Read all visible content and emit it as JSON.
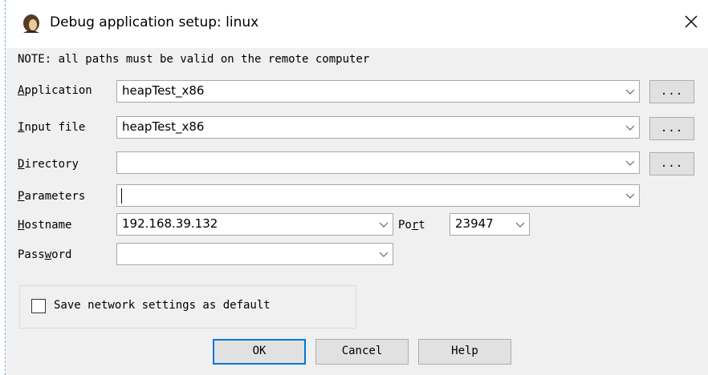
{
  "window": {
    "title": "Debug application setup: linux",
    "icon": "ida-debugger-icon",
    "close_icon": "close-icon"
  },
  "note": "NOTE: all paths must be valid on the remote computer",
  "fields": {
    "application": {
      "mnemonic": "A",
      "rest": "pplication",
      "value": "heapTest_x86",
      "browse_label": "..."
    },
    "input_file": {
      "mnemonic": "I",
      "rest": "nput file",
      "value": "heapTest_x86",
      "browse_label": "..."
    },
    "directory": {
      "mnemonic": "D",
      "rest": "irectory",
      "value": "",
      "browse_label": "..."
    },
    "parameters": {
      "mnemonic": "P",
      "rest": "arameters",
      "value": ""
    },
    "hostname": {
      "mnemonic": "H",
      "rest": "ostname",
      "value": "192.168.39.132"
    },
    "port": {
      "pre": "Po",
      "mnemonic": "r",
      "rest": "t",
      "value": "23947"
    },
    "password": {
      "pre": "Pass",
      "mnemonic": "w",
      "rest": "ord",
      "value": ""
    }
  },
  "save_default": {
    "label": "Save network settings as default",
    "checked": false
  },
  "buttons": {
    "ok": "OK",
    "cancel": "Cancel",
    "help": "Help"
  },
  "colors": {
    "default_button_border": "#0078d7",
    "dialog_bg": "#f0f0f0",
    "button_bg": "#e1e1e1"
  }
}
